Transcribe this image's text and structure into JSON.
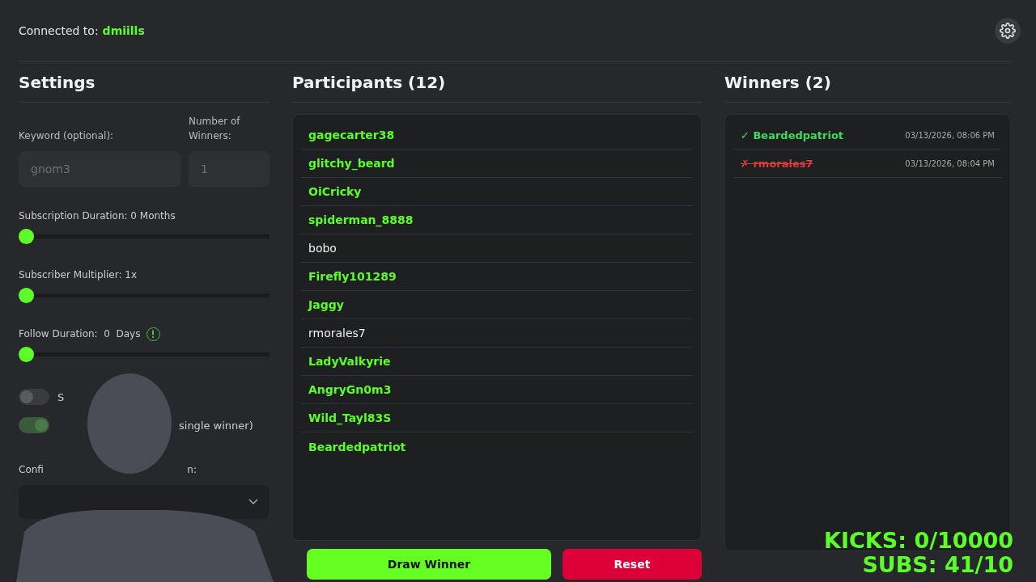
{
  "header": {
    "label": "Connected to:",
    "channel": "dmiills"
  },
  "settings": {
    "title": "Settings",
    "keyword": {
      "label": "Keyword (optional):",
      "placeholder": "gnom3"
    },
    "winners_count": {
      "label": "Number of Winners:",
      "placeholder": "1"
    },
    "sliders": [
      {
        "label": "Subscription Duration: 0 Months",
        "level": 0,
        "info": false
      },
      {
        "label": "Subscriber Multiplier: 1x",
        "level": 0,
        "info": false
      },
      {
        "label": "Follow Duration:  0  Days",
        "level": 0,
        "info": true
      }
    ],
    "toggles": [
      {
        "label": "S",
        "on": false
      },
      {
        "label": "single winner)",
        "on": true
      }
    ],
    "config": {
      "label_left": "Confi",
      "label_right": "n:"
    }
  },
  "participants": {
    "title": "Participants (12)",
    "items": [
      {
        "name": "gagecarter38",
        "highlighted": true
      },
      {
        "name": "glitchy_beard",
        "highlighted": true
      },
      {
        "name": "OiCricky",
        "highlighted": true
      },
      {
        "name": "spiderman_8888",
        "highlighted": true
      },
      {
        "name": "bobo",
        "highlighted": false
      },
      {
        "name": "Firefly101289",
        "highlighted": true
      },
      {
        "name": "Jaggy",
        "highlighted": true
      },
      {
        "name": "rmorales7",
        "highlighted": false
      },
      {
        "name": "LadyValkyrie",
        "highlighted": true
      },
      {
        "name": "AngryGn0m3",
        "highlighted": true
      },
      {
        "name": "Wild_Tayl83S",
        "highlighted": true
      },
      {
        "name": "Beardedpatriot",
        "highlighted": true
      }
    ]
  },
  "buttons": [
    {
      "label": "Draw Winner",
      "kind": "primary"
    },
    {
      "label": "Reset",
      "kind": "danger"
    }
  ],
  "winners": {
    "title": "Winners (2)",
    "items": [
      {
        "mark": "✓",
        "name": "Beardedpatriot",
        "time": "03/13/2026, 08:06 PM",
        "kind": "valid"
      },
      {
        "mark": "✗",
        "name": "rmorales7",
        "time": "03/13/2026, 08:04 PM",
        "kind": "rejected"
      }
    ]
  },
  "stream_overlay": {
    "kicks": "KICKS: 0/10000",
    "subs": "SUBS: 41/10"
  }
}
